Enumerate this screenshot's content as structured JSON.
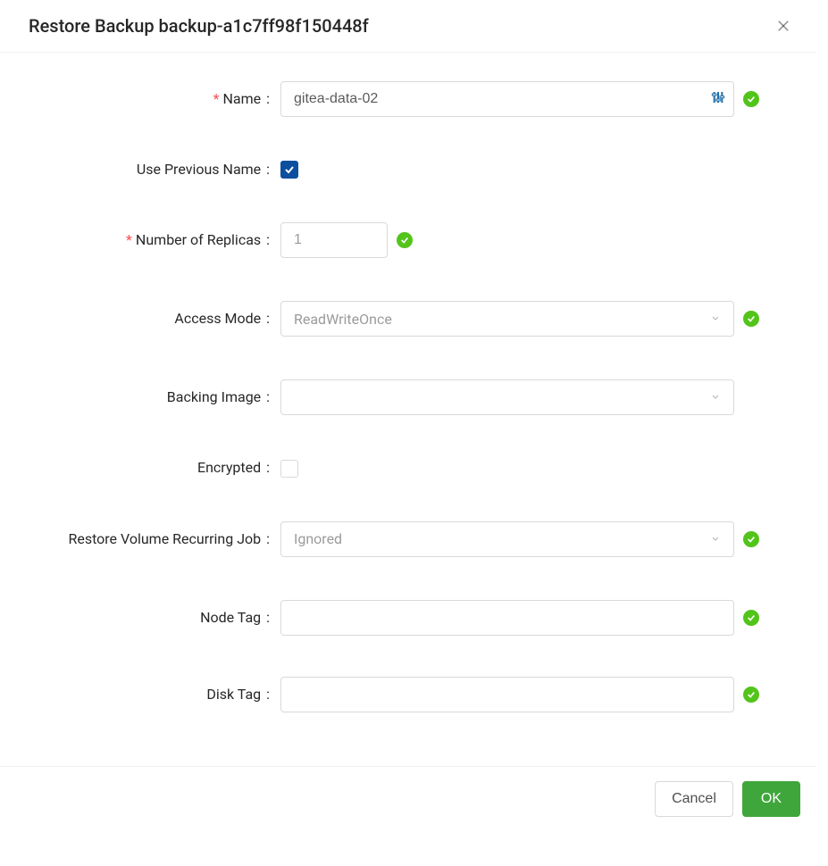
{
  "modal": {
    "title": "Restore Backup backup-a1c7ff98f150448f"
  },
  "form": {
    "name": {
      "label": "Name",
      "value": "gitea-data-02",
      "required": true,
      "valid": true
    },
    "usePrevName": {
      "label": "Use Previous Name",
      "checked": true
    },
    "replicas": {
      "label": "Number of Replicas",
      "value": "1",
      "required": true,
      "valid": true
    },
    "accessMode": {
      "label": "Access Mode",
      "value": "ReadWriteOnce",
      "valid": true
    },
    "backingImage": {
      "label": "Backing Image",
      "value": ""
    },
    "encrypted": {
      "label": "Encrypted",
      "checked": false
    },
    "recurringJob": {
      "label": "Restore Volume Recurring Job",
      "value": "Ignored",
      "valid": true
    },
    "nodeTag": {
      "label": "Node Tag",
      "value": "",
      "valid": true
    },
    "diskTag": {
      "label": "Disk Tag",
      "value": "",
      "valid": true
    }
  },
  "footer": {
    "cancel": "Cancel",
    "ok": "OK"
  }
}
